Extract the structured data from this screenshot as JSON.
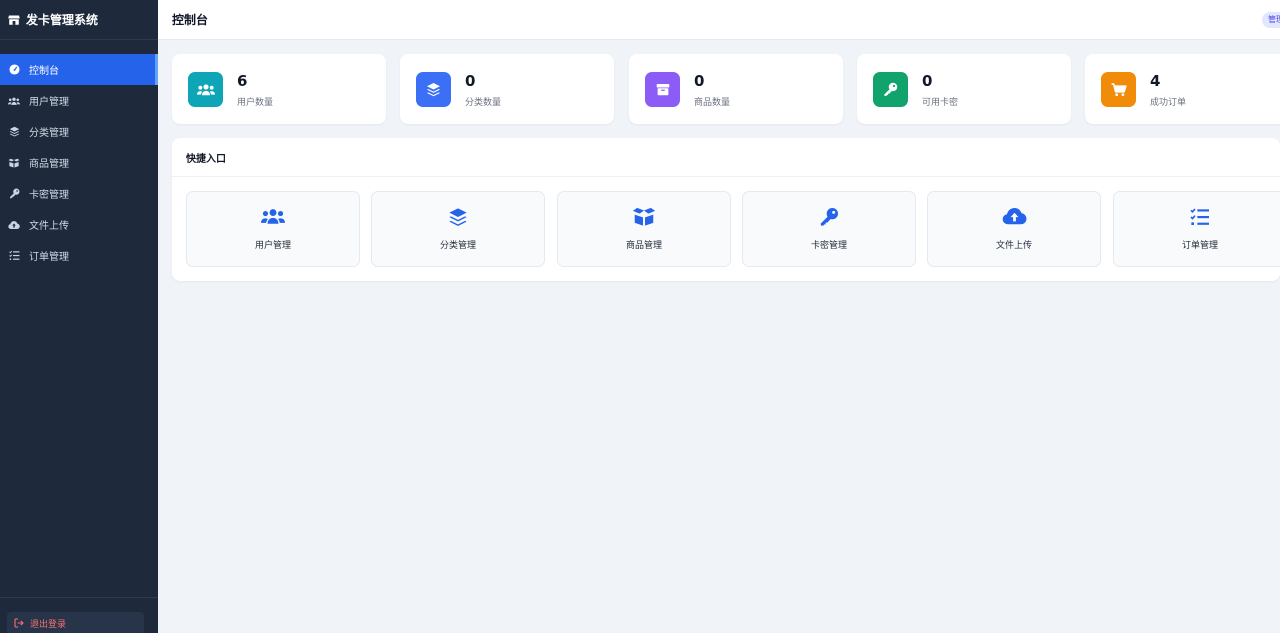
{
  "sidebar": {
    "brand": "发卡管理系统",
    "items": [
      {
        "label": "控制台",
        "icon": "gauge-icon",
        "active": true
      },
      {
        "label": "用户管理",
        "icon": "users-icon"
      },
      {
        "label": "分类管理",
        "icon": "layers-icon"
      },
      {
        "label": "商品管理",
        "icon": "box-icon"
      },
      {
        "label": "卡密管理",
        "icon": "key-icon"
      },
      {
        "label": "文件上传",
        "icon": "cloud-upload-icon"
      },
      {
        "label": "订单管理",
        "icon": "list-check-icon"
      }
    ],
    "logout": "退出登录"
  },
  "header": {
    "title": "控制台",
    "role_badge": "管理员"
  },
  "stats": [
    {
      "value": "6",
      "label": "用户数量",
      "icon": "users-icon",
      "color": "#0ea5b7"
    },
    {
      "value": "0",
      "label": "分类数量",
      "icon": "layers-icon",
      "color": "#3b6ff5"
    },
    {
      "value": "0",
      "label": "商品数量",
      "icon": "box-icon",
      "color": "#8b5cf6"
    },
    {
      "value": "0",
      "label": "可用卡密",
      "icon": "key-icon",
      "color": "#10a36c"
    },
    {
      "value": "4",
      "label": "成功订单",
      "icon": "cart-icon",
      "color": "#f08c0a"
    }
  ],
  "quick": {
    "title": "快捷入口",
    "items": [
      {
        "label": "用户管理",
        "icon": "users-icon"
      },
      {
        "label": "分类管理",
        "icon": "layers-icon"
      },
      {
        "label": "商品管理",
        "icon": "box-open-icon"
      },
      {
        "label": "卡密管理",
        "icon": "key-icon"
      },
      {
        "label": "文件上传",
        "icon": "cloud-upload-icon"
      },
      {
        "label": "订单管理",
        "icon": "list-check-icon"
      }
    ]
  },
  "colors": {
    "sidebar_bg": "#1e293b",
    "accent": "#2563eb",
    "quick_icon": "#2563eb",
    "logout_text": "#f87171"
  }
}
